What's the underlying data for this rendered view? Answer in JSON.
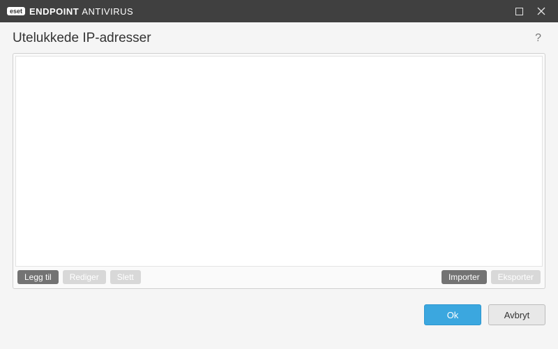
{
  "titlebar": {
    "badge": "eset",
    "product_bold": "ENDPOINT ",
    "product_light": "ANTIVIRUS"
  },
  "page": {
    "title": "Utelukkede IP-adresser",
    "help": "?"
  },
  "list": {
    "items": []
  },
  "toolbar": {
    "add": "Legg til",
    "edit": "Rediger",
    "delete": "Slett",
    "import": "Importer",
    "export": "Eksporter"
  },
  "footer": {
    "ok": "Ok",
    "cancel": "Avbryt"
  }
}
